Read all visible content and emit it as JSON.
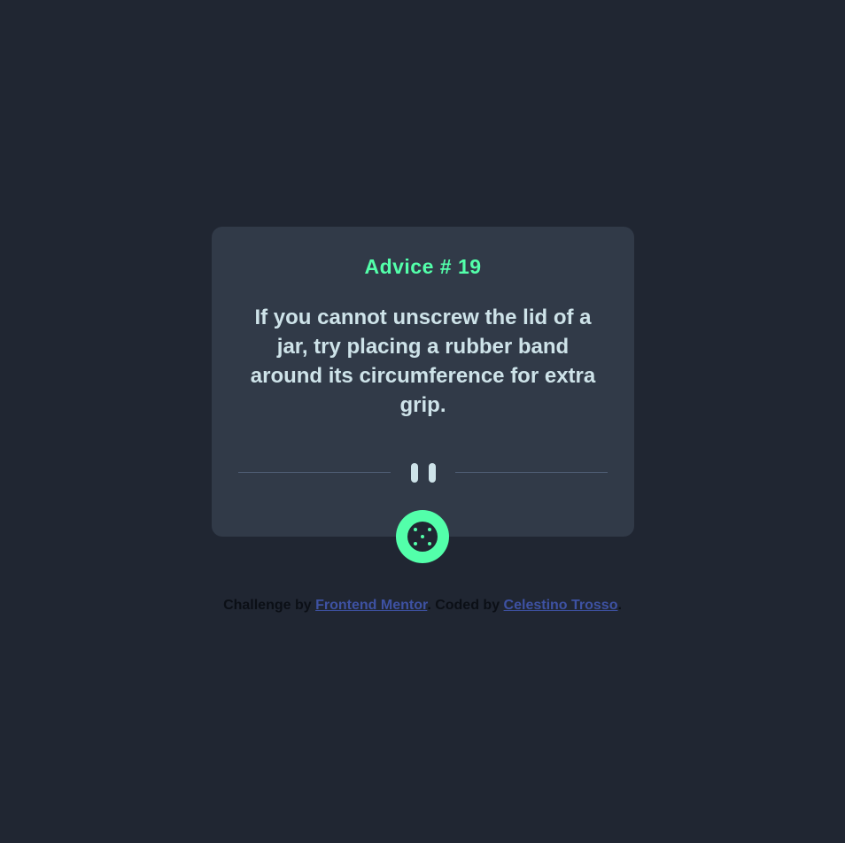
{
  "card": {
    "title": "Advice # 19",
    "advice": "If you cannot unscrew the lid of a jar, try placing a rubber band around its circumference for extra grip."
  },
  "divider": {
    "icon": "pause-icon"
  },
  "dice_button": {
    "icon": "dice-icon"
  },
  "footer": {
    "prefix": "Challenge by ",
    "link1": "Frontend Mentor",
    "middle": ". Coded by ",
    "link2": "Celestino Trosso",
    "suffix": "."
  },
  "colors": {
    "background": "#202632",
    "card": "#313A48",
    "accent": "#53FFAA",
    "text": "#CEE3E9",
    "link": "#3E52A3"
  }
}
